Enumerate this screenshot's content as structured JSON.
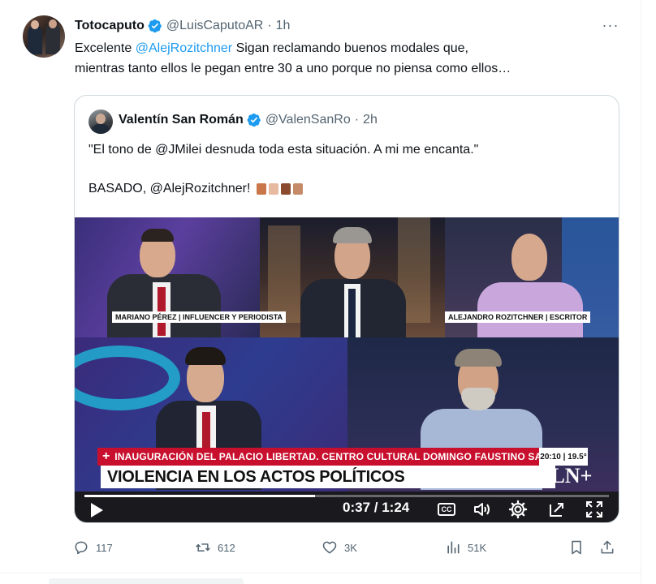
{
  "tweet": {
    "display_name": "Totocaputo",
    "handle": "@LuisCaputoAR",
    "separator": "·",
    "time": "1h",
    "more_label": "···",
    "text_prefix": "Excelente ",
    "mention": "@AlejRozitchner",
    "text_suffix": " Sigan reclamando buenos modales que,",
    "text_line2": "mientras tanto ellos le pegan entre 30 a uno porque no piensa como ellos…"
  },
  "quote": {
    "display_name": "Valentín San Román",
    "handle": "@ValenSanRo",
    "separator": "·",
    "time": "2h",
    "line1": "\"El tono de @JMilei desnuda toda esta situación. A mi me encanta.\"",
    "line2": "BASADO, @AlejRozitchner!",
    "emoji_colors": [
      "#c9774a",
      "#e7b9a0",
      "#8a4b2e",
      "#c58a67"
    ]
  },
  "video": {
    "lower_third_banner": "INAUGURACIÓN DEL PALACIO LIBERTAD. CENTRO CULTURAL DOMINGO FAUSTINO SARMIENTO",
    "banner_plus": "+",
    "clock": "20:10 | 19.5°",
    "headline": "VIOLENCIA EN LOS ACTOS POLÍTICOS",
    "name_tag_left": "MARIANO PÉREZ | INFLUENCER Y PERIODISTA",
    "name_tag_right": "ALEJANDRO ROZITCHNER | ESCRITOR",
    "logo_text": "LN+",
    "current_time": "0:37",
    "duration": "1:24",
    "time_separator": " / ",
    "progress_fraction": 0.44,
    "cc_label": "CC"
  },
  "actions": {
    "replies": "117",
    "retweets": "612",
    "likes": "3K",
    "views": "51K"
  },
  "colors": {
    "accent": "#1d9bf0",
    "secondary_text": "#536471",
    "border": "#cfd9de",
    "banner_red": "#c8102e"
  }
}
